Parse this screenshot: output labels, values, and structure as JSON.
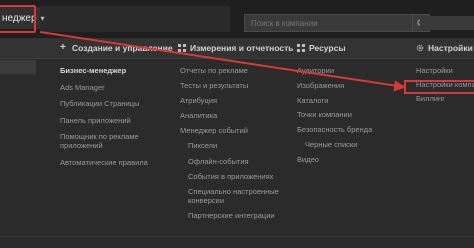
{
  "topbar": {
    "business_manager_label": "неджер",
    "search_placeholder": "Поиск в компании"
  },
  "menu": {
    "sections": [
      {
        "title": "Создание и управление",
        "icon": "plus-icon"
      },
      {
        "title": "Измерения и отчетность",
        "icon": "grid-icon"
      },
      {
        "title": "Ресурсы",
        "icon": "grid-icon"
      },
      {
        "title": "Настройки",
        "icon": "gear-icon"
      }
    ],
    "col1": [
      "Бизнес-менеджер",
      "Ads Manager",
      "Публикации Страницы",
      "Панель приложений",
      "Помощник по рекламе приложений",
      "Автоматические правила"
    ],
    "col2": [
      "Отчеты по рекламе",
      "Тесты и результаты",
      "Атрибуция",
      "Аналитика",
      "Менеджер событий",
      "Пиксели",
      "Офлайн-события",
      "События в приложениях",
      "Специально настроенные конверсии",
      "Партнерские интеграции"
    ],
    "col3": [
      "Аудитории",
      "Изображения",
      "Каталоги",
      "Точки компании",
      "Безопасность бренда",
      "Черные списки",
      "Видео"
    ],
    "col4": [
      "Настройки",
      "Настройки компании",
      "Биллинг"
    ]
  },
  "colors": {
    "background": "#2b2b2b",
    "topbar": "#1f1f1f",
    "highlight_red": "#d43a3a"
  }
}
